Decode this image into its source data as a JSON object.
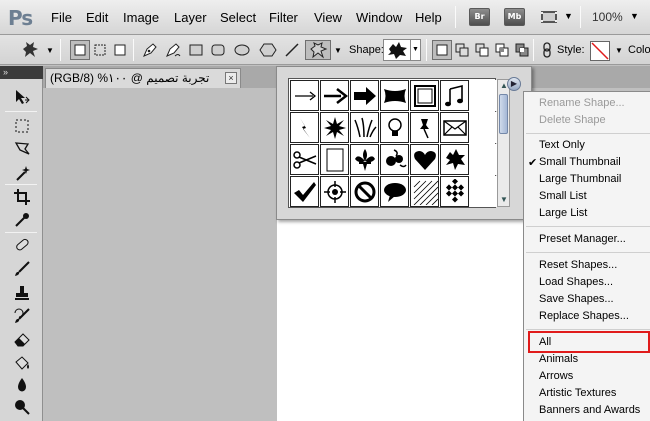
{
  "menubar": {
    "logo": "Ps",
    "items": [
      "File",
      "Edit",
      "Image",
      "Layer",
      "Select",
      "Filter",
      "View",
      "Window",
      "Help"
    ],
    "bridge_label": "Br",
    "minibridge_label": "Mb",
    "zoom": "100%"
  },
  "options_bar": {
    "shape_label": "Shape:",
    "style_label": "Style:",
    "color_label": "Colo"
  },
  "document_tab": {
    "title": "تجربة تصميم @ ١٠٠% (RGB/8)",
    "close": "×"
  },
  "tools_panel": {
    "collapse_glyph": "»"
  },
  "shape_picker": {
    "shapes": [
      "arrow-thin-icon",
      "arrow-medium-icon",
      "arrow-bold-icon",
      "banner-icon",
      "frame-icon",
      "music-note-icon",
      "scroll-up-icon",
      "lightning-icon",
      "starburst-icon",
      "grass-icon",
      "lightbulb-icon",
      "thumbtack-icon",
      "envelope-icon",
      "scroll-mid-icon",
      "scissors-icon",
      "blank-page-icon",
      "fleur-de-lis-icon",
      "ornament-icon",
      "heart-icon",
      "blob-icon",
      "scroll-track-icon",
      "checkmark-icon",
      "crosshair-icon",
      "no-symbol-icon",
      "speech-bubble-icon",
      "hatch-icon",
      "checker-icon",
      "scroll-down-icon"
    ]
  },
  "context_menu": {
    "rename_shape": "Rename Shape...",
    "delete_shape": "Delete Shape",
    "text_only": "Text Only",
    "small_thumbnail": "Small Thumbnail",
    "large_thumbnail": "Large Thumbnail",
    "small_list": "Small List",
    "large_list": "Large List",
    "preset_manager": "Preset Manager...",
    "reset_shapes": "Reset Shapes...",
    "load_shapes": "Load Shapes...",
    "save_shapes": "Save Shapes...",
    "replace_shapes": "Replace Shapes...",
    "all": "All",
    "animals": "Animals",
    "arrows": "Arrows",
    "artistic_textures": "Artistic Textures",
    "banners_and_awards": "Banners and Awards",
    "checked_item": "Small Thumbnail",
    "highlight_color": "#e01b1b"
  }
}
